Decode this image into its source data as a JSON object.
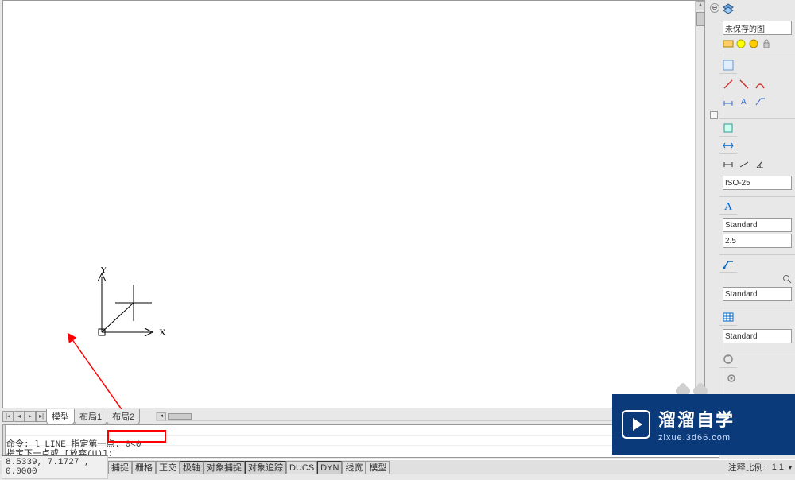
{
  "tabs": {
    "model": "模型",
    "layout1": "布局1",
    "layout2": "布局2"
  },
  "ucs": {
    "x_label": "X",
    "y_label": "Y"
  },
  "command": {
    "line1": "",
    "line2": "命令: l LINE 指定第一点: 0<0",
    "line3": "指定下一点或 [放弃(U)]:"
  },
  "status": {
    "coords": "8.5339, 7.1727 , 0.0000",
    "buttons": [
      "捕捉",
      "栅格",
      "正交",
      "极轴",
      "对象捕捉",
      "对象追踪",
      "DUCS",
      "DYN",
      "线宽",
      "模型"
    ],
    "annot_label": "注释比例:",
    "annot_value": "1:1"
  },
  "right_panel": {
    "layer_dropdown": "未保存的图",
    "dim_style": "ISO-25",
    "text_style": "Standard",
    "text_height": "2.5",
    "leader_style": "Standard",
    "table_style": "Standard"
  },
  "watermark": {
    "cn": "溜溜自学",
    "en": "zixue.3d66.com"
  }
}
